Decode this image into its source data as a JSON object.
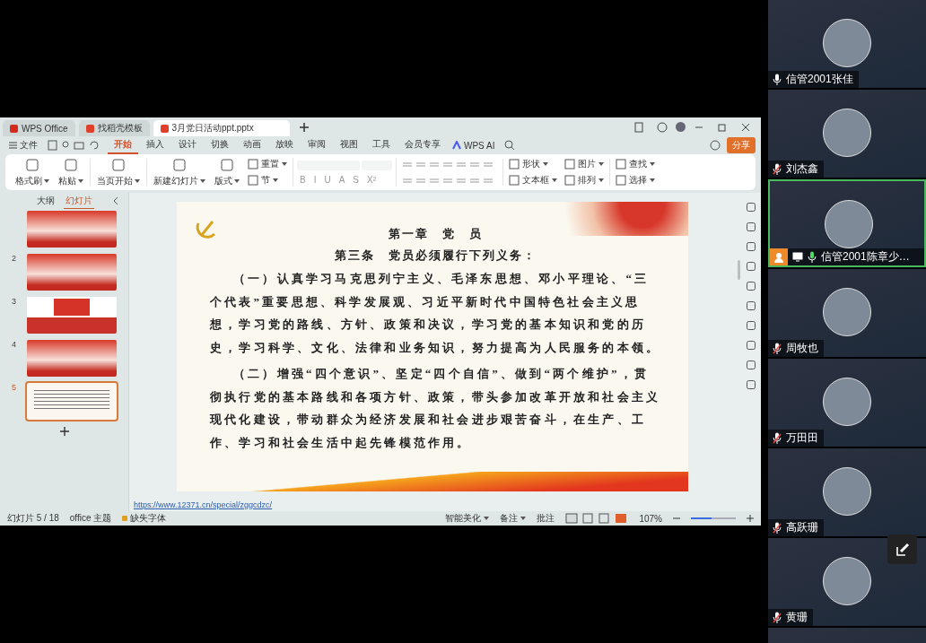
{
  "tabs": [
    {
      "label": "WPS Office",
      "selected": false
    },
    {
      "label": "找稻壳模板",
      "selected": false
    },
    {
      "label": "3月党日活动ppt.pptx",
      "selected": true
    }
  ],
  "menu": {
    "file": "文件",
    "tabs": [
      {
        "label": "开始",
        "selected": true
      },
      {
        "label": "插入",
        "selected": false
      },
      {
        "label": "设计",
        "selected": false
      },
      {
        "label": "切换",
        "selected": false
      },
      {
        "label": "动画",
        "selected": false
      },
      {
        "label": "放映",
        "selected": false
      },
      {
        "label": "审阅",
        "selected": false
      },
      {
        "label": "视图",
        "selected": false
      },
      {
        "label": "工具",
        "selected": false
      },
      {
        "label": "会员专享",
        "selected": false
      }
    ],
    "ai": "WPS AI",
    "share": "分享"
  },
  "ribbon": [
    {
      "kind": "large",
      "items": [
        "格式刷"
      ]
    },
    {
      "kind": "large",
      "items": [
        "粘贴"
      ]
    },
    {
      "kind": "sep"
    },
    {
      "kind": "large",
      "items": [
        "当页开始"
      ]
    },
    {
      "kind": "sep"
    },
    {
      "kind": "large",
      "items": [
        "新建幻灯片"
      ]
    },
    {
      "kind": "large",
      "items": [
        "版式"
      ]
    },
    {
      "kind": "stack",
      "items": [
        "重置",
        "节"
      ]
    },
    {
      "kind": "sep"
    },
    {
      "kind": "format",
      "items": [
        "B",
        "I",
        "U",
        "A",
        "S",
        "X²"
      ]
    },
    {
      "kind": "sep"
    },
    {
      "kind": "paragraph"
    },
    {
      "kind": "sep"
    },
    {
      "kind": "stack",
      "items": [
        "形状",
        "文本框"
      ]
    },
    {
      "kind": "stack",
      "items": [
        "图片",
        "排列"
      ]
    },
    {
      "kind": "sep"
    },
    {
      "kind": "stack",
      "items": [
        "查找",
        "选择"
      ]
    }
  ],
  "side_panel": {
    "tabs": [
      {
        "label": "大纲",
        "selected": false
      },
      {
        "label": "幻灯片",
        "selected": true
      }
    ],
    "slides": [
      {
        "kind": "title",
        "selected": false
      },
      {
        "number": "2",
        "kind": "title",
        "selected": false
      },
      {
        "number": "3",
        "kind": "flag",
        "selected": false
      },
      {
        "number": "4",
        "kind": "title",
        "selected": false
      },
      {
        "number": "5",
        "kind": "text",
        "selected": true
      }
    ]
  },
  "slide": {
    "title": "第一章　党　员",
    "subtitle": "第三条　党员必须履行下列义务：",
    "paragraphs": [
      "（一）认真学习马克思列宁主义、毛泽东思想、邓小平理论、“三个代表”重要思想、科学发展观、习近平新时代中国特色社会主义思想，学习党的路线、方针、政策和决议，学习党的基本知识和党的历史，学习科学、文化、法律和业务知识，努力提高为人民服务的本领。",
      "（二）增强“四个意识”、坚定“四个自信”、做到“两个维护”，贯彻执行党的基本路线和各项方针、政策，带头参加改革开放和社会主义现代化建设，带动群众为经济发展和社会进步艰苦奋斗，在生产、工作、学习和社会生活中起先锋模范作用。"
    ]
  },
  "link": "https://www.12371.cn/special/zggcdzc/",
  "status_bar": {
    "slide_counter": "幻灯片 5 / 18",
    "theme": "office 主题",
    "missing_font": "缺失字体",
    "beautify": "智能美化",
    "notes": "备注",
    "comments": "批注",
    "zoom": "107%",
    "zoom_slider": {
      "level": 0.45
    }
  },
  "participants": [
    {
      "name": "信管2001张佳",
      "muted": false,
      "speaking": false,
      "selected": false,
      "host": false,
      "sharing": false
    },
    {
      "name": "刘杰鑫",
      "muted": true,
      "speaking": false,
      "selected": false,
      "host": false,
      "sharing": false
    },
    {
      "name": "信管2001陈章少…",
      "muted": false,
      "speaking": true,
      "selected": true,
      "host": true,
      "sharing": true
    },
    {
      "name": "周牧也",
      "muted": true,
      "speaking": false,
      "selected": false,
      "host": false,
      "sharing": false
    },
    {
      "name": "万田田",
      "muted": true,
      "speaking": false,
      "selected": false,
      "host": false,
      "sharing": false
    },
    {
      "name": "高跃珊",
      "muted": true,
      "speaking": false,
      "selected": false,
      "host": false,
      "sharing": false
    },
    {
      "name": "黄珊",
      "muted": true,
      "speaking": false,
      "selected": false,
      "host": false,
      "sharing": false
    }
  ]
}
